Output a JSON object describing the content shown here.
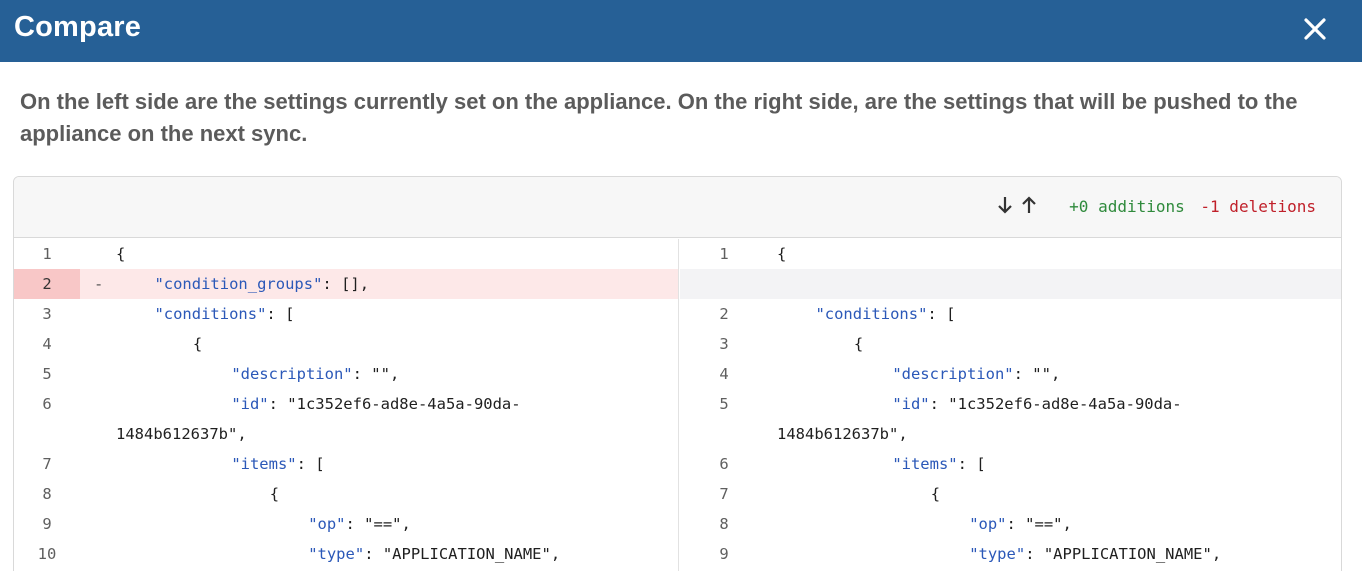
{
  "dialog": {
    "title": "Compare",
    "close_icon": "close-icon",
    "header_color": "#266096"
  },
  "description": "On the left side are the settings currently set on the appliance. On the right side, are the settings that will be pushed to the appliance on the next sync.",
  "toolbar": {
    "down_icon": "arrow-down-icon",
    "up_icon": "arrow-up-icon",
    "additions": "+0 additions",
    "deletions": "-1 deletions",
    "addition_color": "#2f8a3c",
    "deletion_color": "#c0202a"
  },
  "left": [
    {
      "num": "1",
      "marker": "",
      "indent": 0,
      "key": "",
      "rest": "{",
      "state": "normal"
    },
    {
      "num": "2",
      "marker": "-",
      "indent": 4,
      "key": "\"condition_groups\"",
      "rest": ": [],",
      "state": "removed"
    },
    {
      "num": "3",
      "marker": "",
      "indent": 4,
      "key": "\"conditions\"",
      "rest": ": [",
      "state": "normal"
    },
    {
      "num": "4",
      "marker": "",
      "indent": 8,
      "key": "",
      "rest": "{",
      "state": "normal"
    },
    {
      "num": "5",
      "marker": "",
      "indent": 12,
      "key": "\"description\"",
      "rest": ": \"\",",
      "state": "normal"
    },
    {
      "num": "6",
      "marker": "",
      "indent": 12,
      "key": "\"id\"",
      "rest": ": \"1c352ef6-ad8e-4a5a-90da-",
      "state": "normal"
    },
    {
      "num": "",
      "marker": "",
      "indent": 0,
      "key": "",
      "rest": "1484b612637b\",",
      "state": "wrap"
    },
    {
      "num": "7",
      "marker": "",
      "indent": 12,
      "key": "\"items\"",
      "rest": ": [",
      "state": "normal"
    },
    {
      "num": "8",
      "marker": "",
      "indent": 16,
      "key": "",
      "rest": "{",
      "state": "normal"
    },
    {
      "num": "9",
      "marker": "",
      "indent": 20,
      "key": "\"op\"",
      "rest": ": \"==\",",
      "state": "normal"
    },
    {
      "num": "10",
      "marker": "",
      "indent": 20,
      "key": "\"type\"",
      "rest": ": \"APPLICATION_NAME\",",
      "state": "normal"
    }
  ],
  "right": [
    {
      "num": "1",
      "marker": "",
      "indent": 0,
      "key": "",
      "rest": "{",
      "state": "normal"
    },
    {
      "num": "",
      "marker": "",
      "indent": 0,
      "key": "",
      "rest": "",
      "state": "empty"
    },
    {
      "num": "2",
      "marker": "",
      "indent": 4,
      "key": "\"conditions\"",
      "rest": ": [",
      "state": "normal"
    },
    {
      "num": "3",
      "marker": "",
      "indent": 8,
      "key": "",
      "rest": "{",
      "state": "normal"
    },
    {
      "num": "4",
      "marker": "",
      "indent": 12,
      "key": "\"description\"",
      "rest": ": \"\",",
      "state": "normal"
    },
    {
      "num": "5",
      "marker": "",
      "indent": 12,
      "key": "\"id\"",
      "rest": ": \"1c352ef6-ad8e-4a5a-90da-",
      "state": "normal"
    },
    {
      "num": "",
      "marker": "",
      "indent": 0,
      "key": "",
      "rest": "1484b612637b\",",
      "state": "wrap"
    },
    {
      "num": "6",
      "marker": "",
      "indent": 12,
      "key": "\"items\"",
      "rest": ": [",
      "state": "normal"
    },
    {
      "num": "7",
      "marker": "",
      "indent": 16,
      "key": "",
      "rest": "{",
      "state": "normal"
    },
    {
      "num": "8",
      "marker": "",
      "indent": 20,
      "key": "\"op\"",
      "rest": ": \"==\",",
      "state": "normal"
    },
    {
      "num": "9",
      "marker": "",
      "indent": 20,
      "key": "\"type\"",
      "rest": ": \"APPLICATION_NAME\",",
      "state": "normal"
    }
  ]
}
